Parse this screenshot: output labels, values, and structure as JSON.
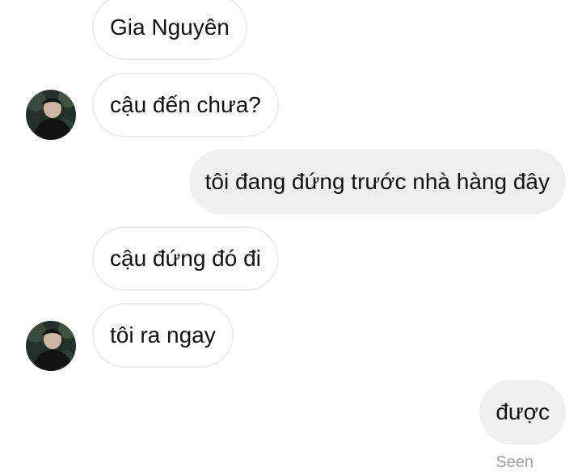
{
  "messages": [
    {
      "text": "Gia Nguyên",
      "direction": "incoming"
    },
    {
      "text": "cậu đến chưa?",
      "direction": "incoming"
    },
    {
      "text": "tôi đang đứng trước nhà hàng đây",
      "direction": "outgoing"
    },
    {
      "text": "cậu đứng đó đi",
      "direction": "incoming"
    },
    {
      "text": "tôi ra ngay",
      "direction": "incoming"
    },
    {
      "text": "được",
      "direction": "outgoing"
    }
  ],
  "status": {
    "seen": "Seen"
  },
  "colors": {
    "incoming_bg": "#ffffff",
    "incoming_border": "#ececec",
    "outgoing_bg": "#efefef",
    "text": "#111111",
    "seen_text": "#a0a0a0"
  },
  "icons": {
    "avatar": "profile-photo"
  }
}
